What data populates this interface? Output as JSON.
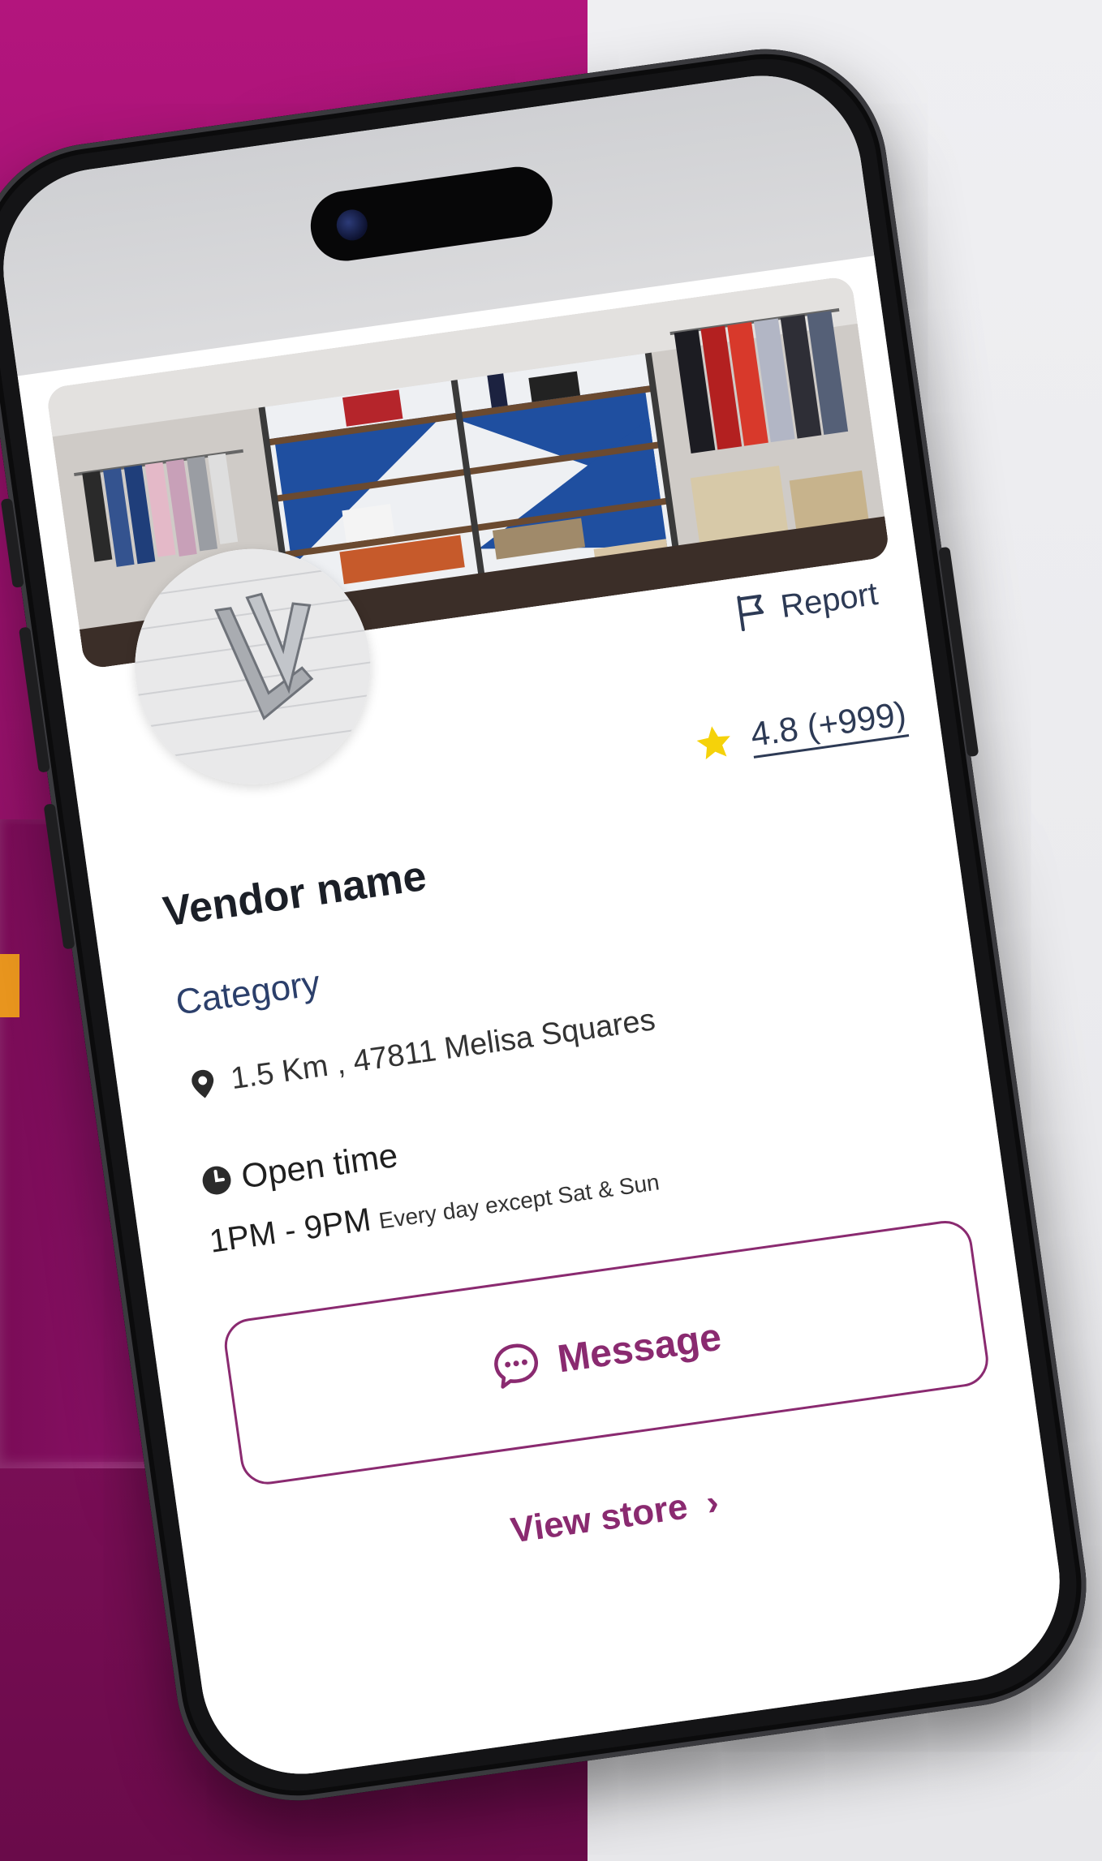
{
  "colors": {
    "brand": "#8a2a70",
    "navy": "#2b3f6b",
    "star": "#f5d20a",
    "background_magenta": "#a0167a"
  },
  "vendor": {
    "name": "Vendor name",
    "category": "Category",
    "distance": "1.5 Km",
    "address": "47811 Melisa Squares",
    "address_line": "1.5 Km , 47811 Melisa Squares",
    "open_time_label": "Open time",
    "hours": "1PM - 9PM",
    "hours_note": "Every day except Sat & Sun"
  },
  "rating": {
    "value": "4.8",
    "count": "(+999)",
    "display": "4.8 (+999)"
  },
  "actions": {
    "report_label": "Report",
    "message_label": "Message",
    "view_store_label": "View store",
    "view_store_chevron": "›"
  },
  "icons": {
    "report": "flag-icon",
    "rating": "star-icon",
    "location": "location-pin-icon",
    "clock": "clock-icon",
    "message": "chat-bubble-icon",
    "chevron": "chevron-right-icon"
  }
}
